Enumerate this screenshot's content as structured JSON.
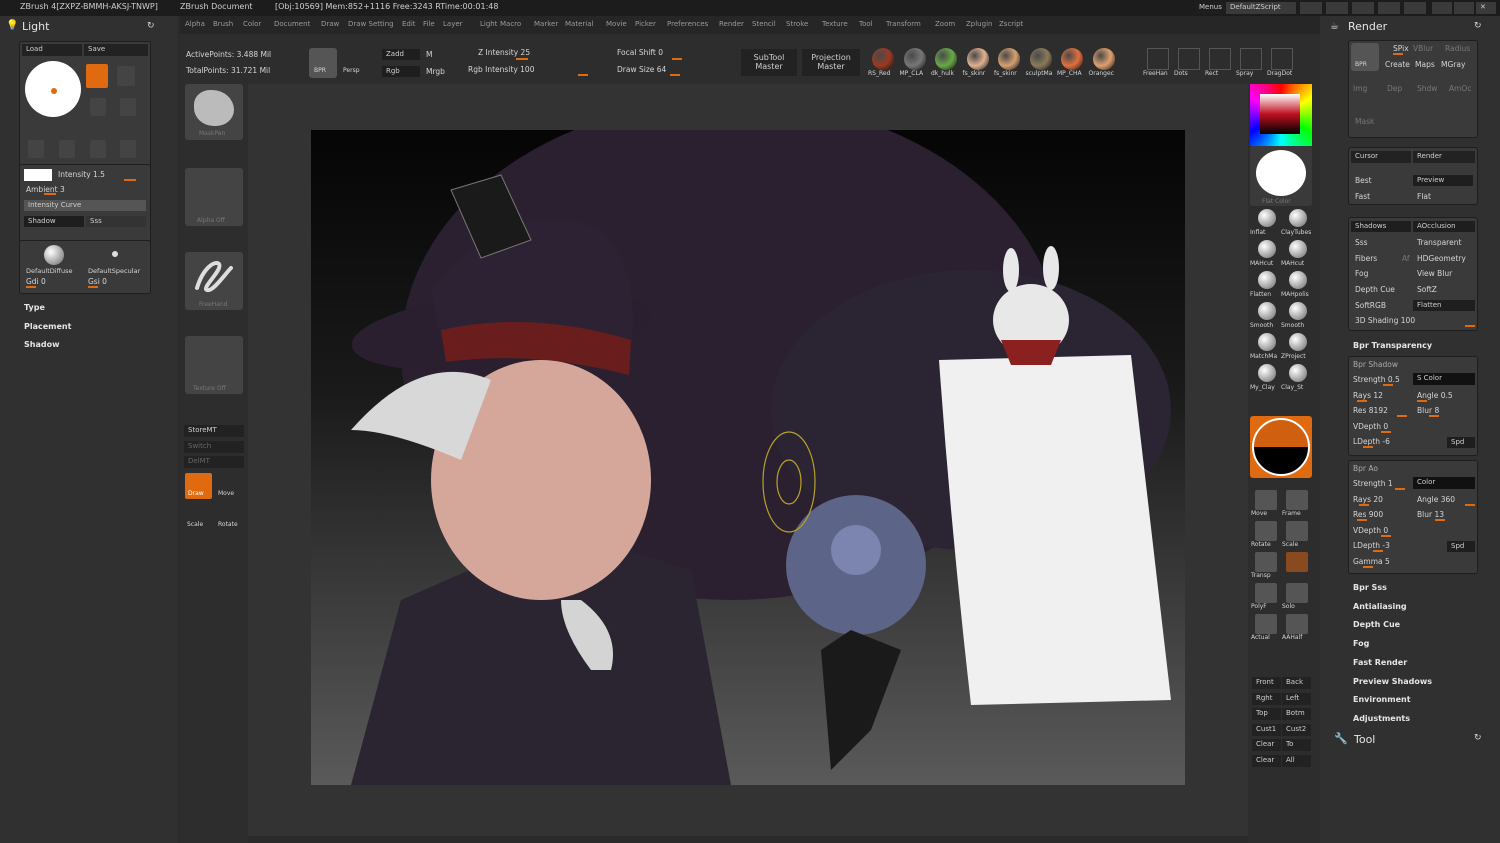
{
  "title_bar": {
    "app": "ZBrush 4[ZXPZ-BMMH-AKSJ-TNWP]",
    "document": "ZBrush Document",
    "stats": "[Obj:10569] Mem:852+1116 Free:3243 RTime:00:01:48",
    "menus_button": "Menus",
    "script_button": "DefaultZScript"
  },
  "menu": [
    "Alpha",
    "Brush",
    "Color",
    "Document",
    "Draw",
    "Draw Setting",
    "Edit",
    "File",
    "Layer",
    "Light",
    "Macro",
    "Marker",
    "Material",
    "Movie",
    "Picker",
    "Preferences",
    "Render",
    "Stencil",
    "Stroke",
    "Texture",
    "Tool",
    "Transform",
    "Zoom",
    "Zplugin",
    "Zscript"
  ],
  "top_shelf": {
    "active_points": "ActivePoints: 3.488 Mil",
    "total_points": "TotalPoints: 31.721 Mil",
    "bpr": "BPR",
    "persp": "Persp",
    "zadd": "Zadd",
    "m": "M",
    "rgb": "Rgb",
    "mrgb": "Mrgb",
    "z_intensity": "Z Intensity 25",
    "rgb_intensity": "Rgb Intensity 100",
    "focal_shift": "Focal Shift 0",
    "draw_size": "Draw Size 64",
    "subtool_master": "SubTool Master",
    "projection_master": "Projection Master",
    "materials": [
      "RS_Red",
      "MP_CLA",
      "dk_hulk",
      "fs_skinr",
      "fs_skinr",
      "sculptMa",
      "MP_CHA",
      "Orangec"
    ],
    "strokes": [
      "FreeHan",
      "Dots",
      "Rect",
      "Spray",
      "DragDot"
    ]
  },
  "light_panel": {
    "title": "Light",
    "load": "Load",
    "save": "Save",
    "intensity": "Intensity 1.5",
    "ambient": "Ambient 3",
    "intensity_curve": "Intensity Curve",
    "shadow": "Shadow",
    "sss": "Sss",
    "default_diffuse": "DefaultDiffuse",
    "default_specular": "DefaultSpecular",
    "gdi": "Gdi 0",
    "gsi": "Gsi 0",
    "sections": [
      "Type",
      "Placement",
      "Shadow"
    ]
  },
  "left_shelf": {
    "maskpen": "MaskPen",
    "alpha_off": "Alpha Off",
    "freehand": "FreeHand",
    "texture_off": "Texture Off",
    "storemt": "StoreMT",
    "switch": "Switch",
    "delmt": "DelMT",
    "draw": "Draw",
    "move": "Move",
    "scale": "Scale",
    "rotate": "Rotate"
  },
  "right_shelf": {
    "flat_color": "Flat Color",
    "brushes": [
      "Inflat",
      "ClayTubes",
      "MAHcut",
      "MAHcut",
      "Flatten",
      "MAHpolis",
      "Smooth",
      "Smooth",
      "MatchMa",
      "ZProject",
      "My_Clay",
      "Clay_St"
    ],
    "nav": [
      "Move",
      "Frame",
      "Rotate",
      "Scale",
      "Transp",
      "",
      "PolyF",
      "Solo",
      "Actual",
      "AAHalf"
    ],
    "views": [
      "Front",
      "Back",
      "Rght",
      "Left",
      "Top",
      "Botm",
      "Cust1",
      "Cust2",
      "Clear",
      "To",
      "Clear",
      "All"
    ]
  },
  "render_panel": {
    "title": "Render",
    "bpr": "BPR",
    "spix": "SPix",
    "vblur": "VBlur",
    "radius": "Radius",
    "create": "Create",
    "maps": "Maps",
    "mgray": "MGray",
    "img": "Img",
    "dep": "Dep",
    "shdw": "Shdw",
    "amoc": "AmOc",
    "mask": "Mask",
    "cursor": "Cursor",
    "render": "Render",
    "best": "Best",
    "preview": "Preview",
    "fast": "Fast",
    "flat": "Flat",
    "shadows": "Shadows",
    "aocclusion": "AOcclusion",
    "sss": "Sss",
    "transparent": "Transparent",
    "fibers": "Fibers",
    "af": "Af",
    "hdgeometry": "HDGeometry",
    "fog": "Fog",
    "view_blur": "View Blur",
    "depth_cue": "Depth Cue",
    "softz": "SoftZ",
    "softrgb": "SoftRGB",
    "flatten": "Flatten",
    "shading": "3D Shading 100",
    "bpr_transparency": "Bpr Transparency",
    "bpr_shadow": "Bpr Shadow",
    "strength": "Strength 0.5",
    "s_color": "S Color",
    "angle": "Angle 0.5",
    "rays": "Rays 12",
    "res": "Res 8192",
    "blur": "Blur 8",
    "vdepth": "VDepth 0",
    "ldepth": "LDepth -6",
    "spd": "Spd",
    "bpr_ao": "Bpr Ao",
    "ao_strength": "Strength 1",
    "ao_color": "Color",
    "ao_rays": "Rays 20",
    "ao_angle": "Angle 360",
    "ao_res": "Res 900",
    "ao_blur": "Blur 13",
    "ao_vdepth": "VDepth 0",
    "ao_ldepth": "LDepth -3",
    "ao_spd": "Spd",
    "gamma": "Gamma 5",
    "sections": [
      "Bpr Sss",
      "Antialiasing",
      "Depth Cue",
      "Fog",
      "Fast Render",
      "Preview Shadows",
      "Environment",
      "Adjustments"
    ],
    "tool": "Tool"
  },
  "colors": {
    "accent": "#e06a10",
    "bg": "#2a2a2a"
  }
}
